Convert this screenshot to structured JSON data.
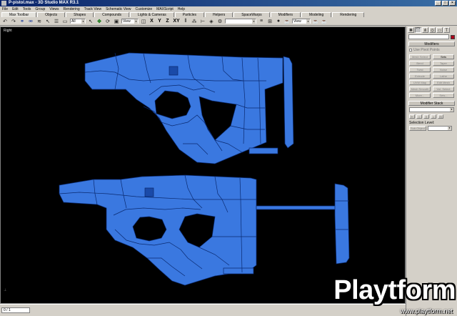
{
  "window": {
    "title": "P-pistol.max - 3D Studio MAX R3.1"
  },
  "menu": [
    "File",
    "Edit",
    "Tools",
    "Group",
    "Views",
    "Rendering",
    "Track View",
    "Schematic View",
    "Customize",
    "MAXScript",
    "Help"
  ],
  "tabs": [
    "Max Toolbar",
    "Objects",
    "Shapes",
    "Compounds",
    "Lights & Cameras",
    "Particles",
    "Helpers",
    "SpaceWarps",
    "Modifiers",
    "Modeling",
    "Rendering"
  ],
  "toolbar": {
    "selection_filter": "All",
    "ref_coord": "View",
    "axes": [
      "X",
      "Y",
      "Z",
      "XY"
    ],
    "named_selection": "",
    "render_view": "View"
  },
  "viewport": {
    "label": "Right"
  },
  "panel": {
    "rollout_modifiers": "Modifiers",
    "use_pivot_points": "Use Pivot Points",
    "modifier_buttons": [
      "Mesh Select",
      "Sets",
      "Bend",
      "Taper",
      "Twist",
      "Noise",
      "Extrude",
      "Lathe",
      "UVW Map",
      "Edit Mesh",
      "Mesh Smooth",
      "Vol. Select",
      "More...",
      "Sets..."
    ],
    "rollout_stack": "Modifier Stack",
    "selection_level": "Selection Level:",
    "sub_object": "Sub-Object"
  },
  "status": {
    "field": "0 / 1"
  },
  "watermark": {
    "text": "Playtform",
    "url": "www.playtform.net"
  },
  "colors": {
    "mesh": "#3a78e0",
    "viewport_bg": "#000000",
    "title_bar": "#0a246a"
  }
}
